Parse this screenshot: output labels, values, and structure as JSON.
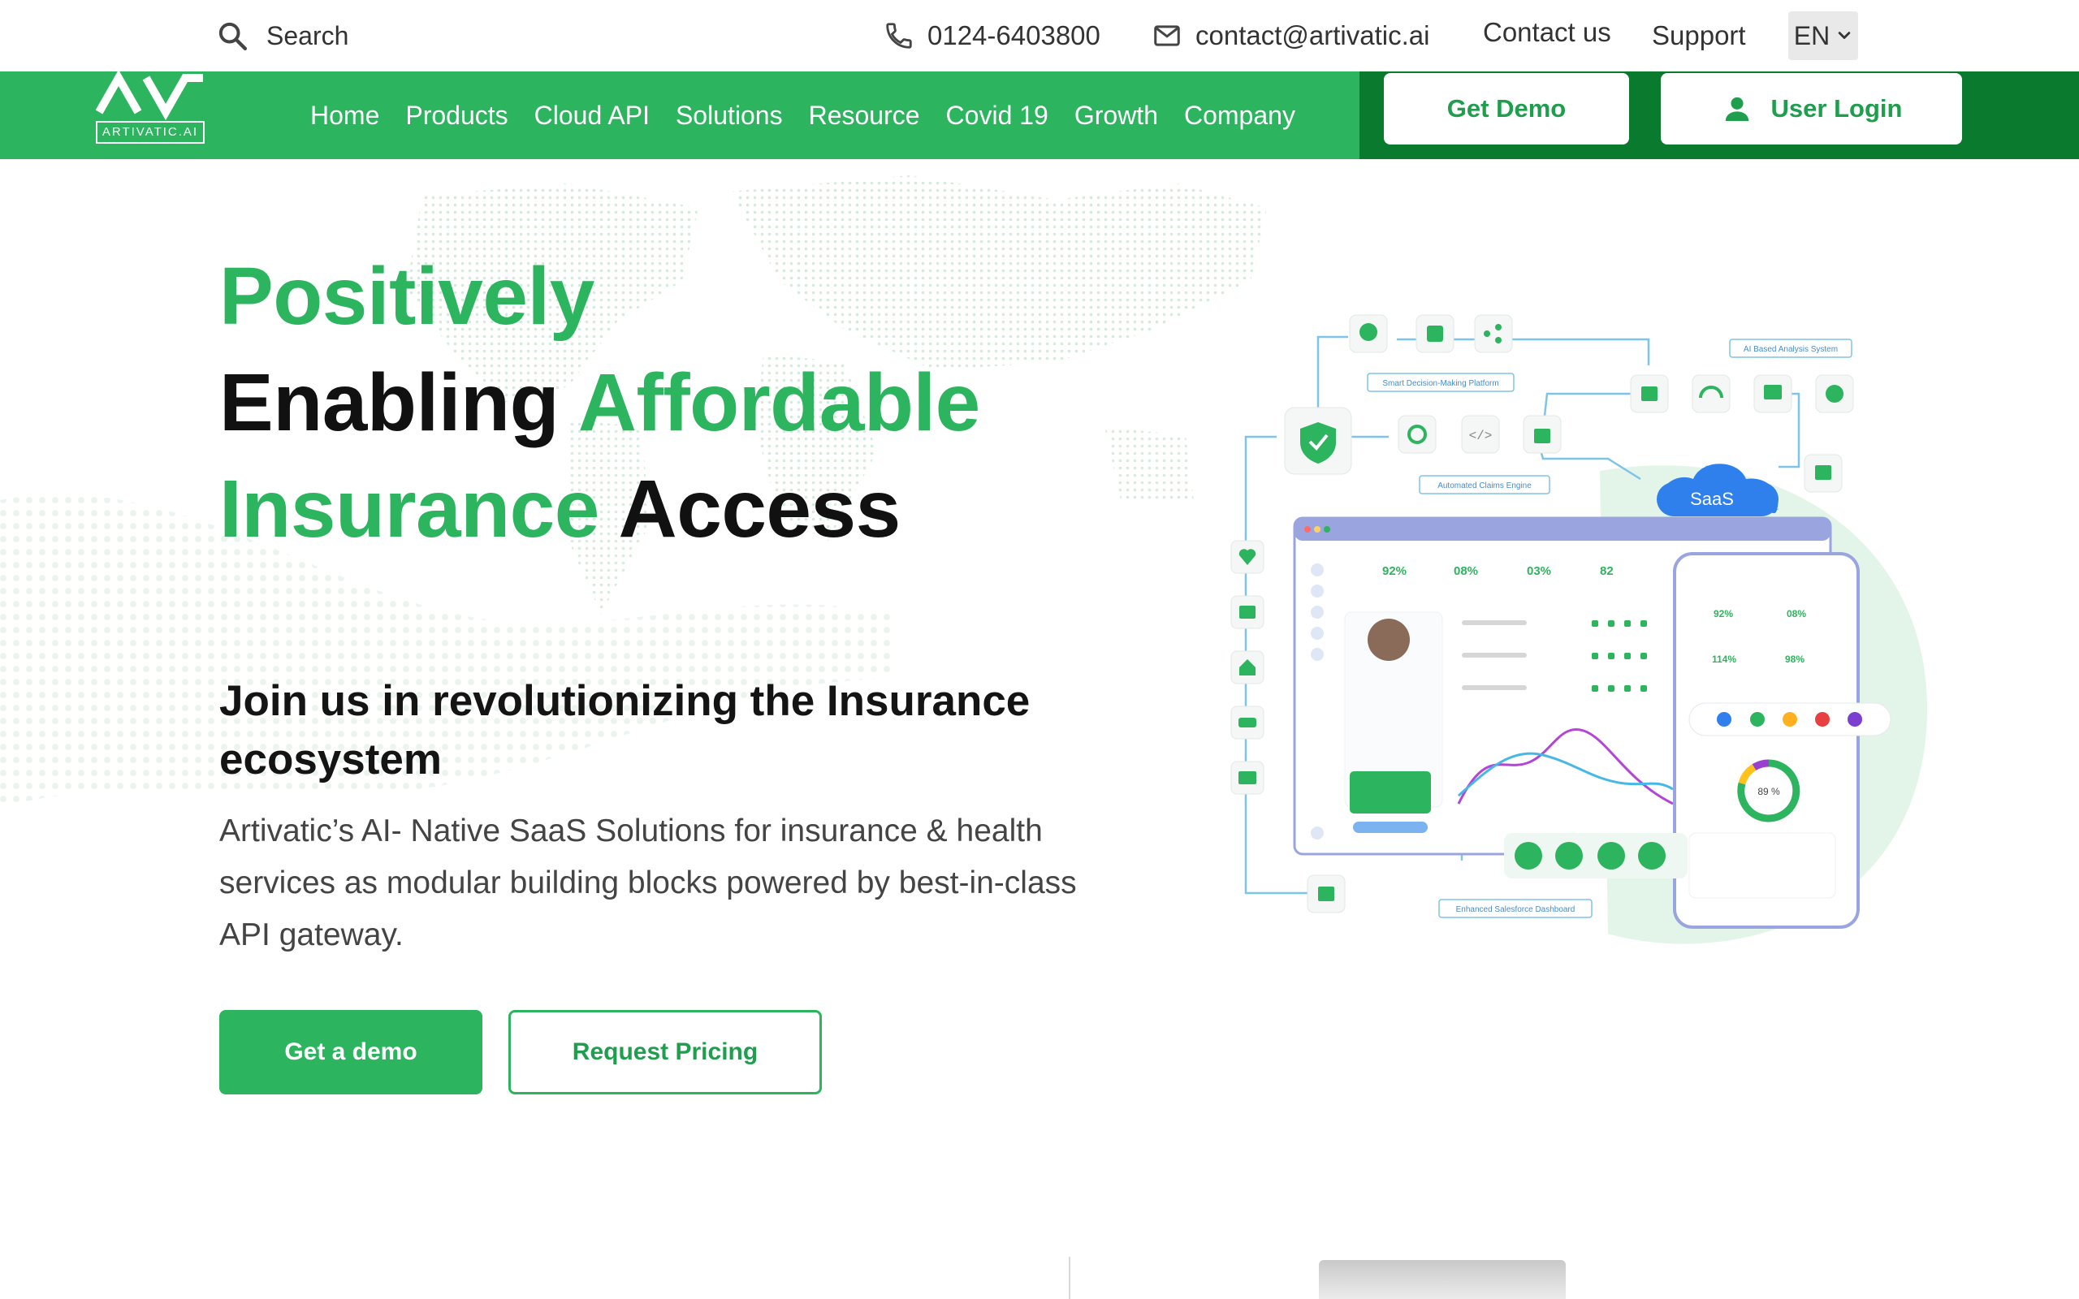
{
  "topbar": {
    "search_label": "Search",
    "phone": "0124-6403800",
    "email": "contact@artivatic.ai",
    "contact_us": "Contact us",
    "support": "Support",
    "language": "EN"
  },
  "navbar": {
    "logo_text": "ARTIVATIC.AI",
    "items": [
      "Home",
      "Products",
      "Cloud API",
      "Solutions",
      "Resource",
      "Covid 19",
      "Growth",
      "Company"
    ],
    "get_demo": "Get Demo",
    "user_login": "User Login"
  },
  "hero": {
    "title_line1_green": "Positively",
    "title_line2_black": "Enabling ",
    "title_line2_green": "Affordable",
    "title_line3_green": "Insurance ",
    "title_line3_black": "Access",
    "subtitle": "Join us in revolutionizing the Insurance ecosystem",
    "description": "Artivatic’s AI- Native SaaS Solutions for insurance & health services as modular building blocks powered by best-in-class API gateway.",
    "btn_demo": "Get a demo",
    "btn_pricing": "Request Pricing"
  },
  "illustration": {
    "labels": {
      "smart_decision": "Smart Decision-Making Platform",
      "ai_analysis": "AI Based Analysis System",
      "claims_engine": "Automated Claims Engine",
      "salesforce": "Enhanced Salesforce Dashboard",
      "saas": "SaaS"
    },
    "stats": [
      "92%",
      "08%",
      "03%",
      "82"
    ],
    "phone_stats": [
      "92%",
      "08%",
      "114%",
      "98%"
    ],
    "donut_value": "89 %"
  },
  "colors": {
    "brand_green": "#2db45e",
    "dark_green": "#0a7a2f",
    "cloud_blue": "#2f80ed"
  }
}
